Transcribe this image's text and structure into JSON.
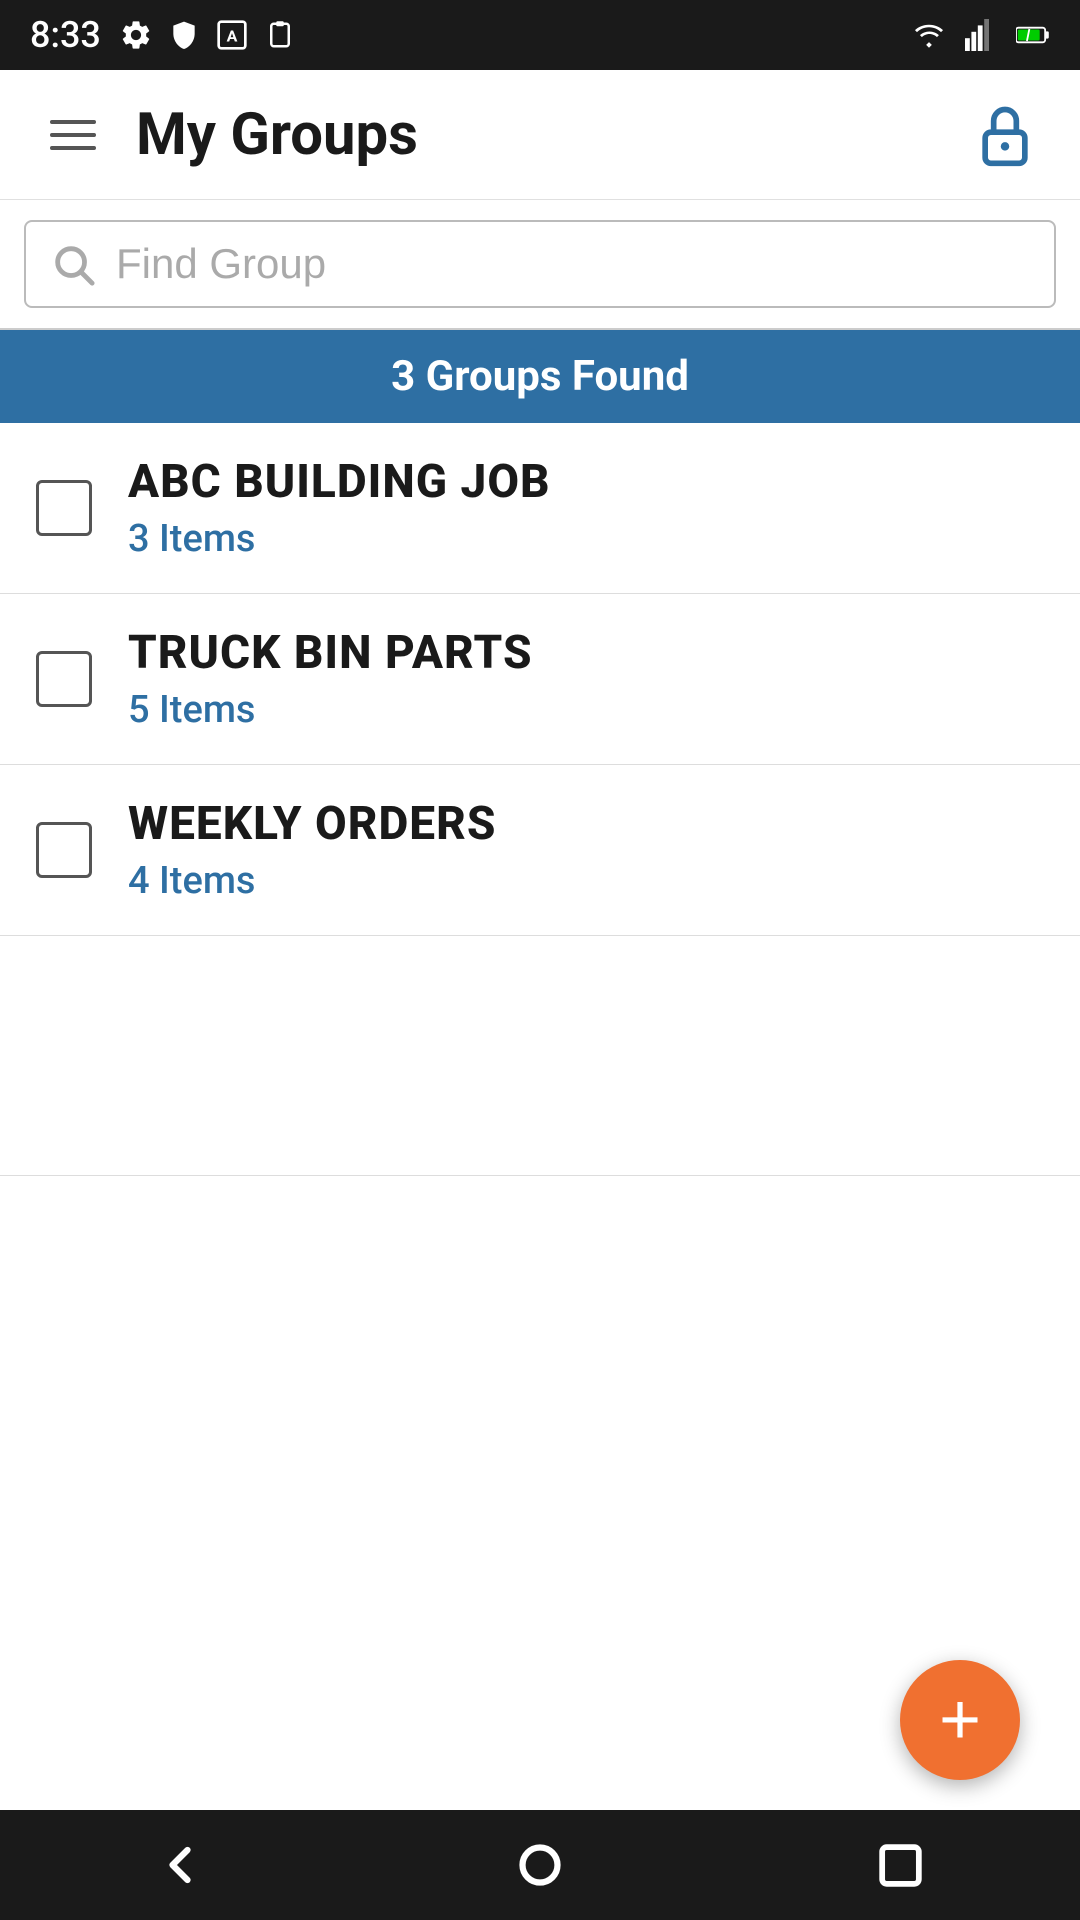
{
  "statusBar": {
    "time": "8:33",
    "icons": [
      "settings-icon",
      "shield-icon",
      "font-icon",
      "clipboard-icon"
    ],
    "rightIcons": [
      "wifi-icon",
      "signal-icon",
      "battery-icon"
    ]
  },
  "appBar": {
    "title": "My Groups",
    "menuIcon": "menu-icon",
    "lockIcon": "lock-icon"
  },
  "search": {
    "placeholder": "Find Group",
    "value": ""
  },
  "resultsBanner": {
    "text": "3 Groups Found"
  },
  "groups": [
    {
      "name": "ABC BUILDING JOB",
      "itemCount": "3 Items",
      "checked": false
    },
    {
      "name": "TRUCK BIN PARTS",
      "itemCount": "5 Items",
      "checked": false
    },
    {
      "name": "WEEKLY ORDERS",
      "itemCount": "4 Items",
      "checked": false
    }
  ],
  "fab": {
    "label": "+",
    "ariaLabel": "Add Group"
  },
  "colors": {
    "accent": "#2e6fa3",
    "fab": "#f07030",
    "itemCount": "#2e6fa3"
  }
}
